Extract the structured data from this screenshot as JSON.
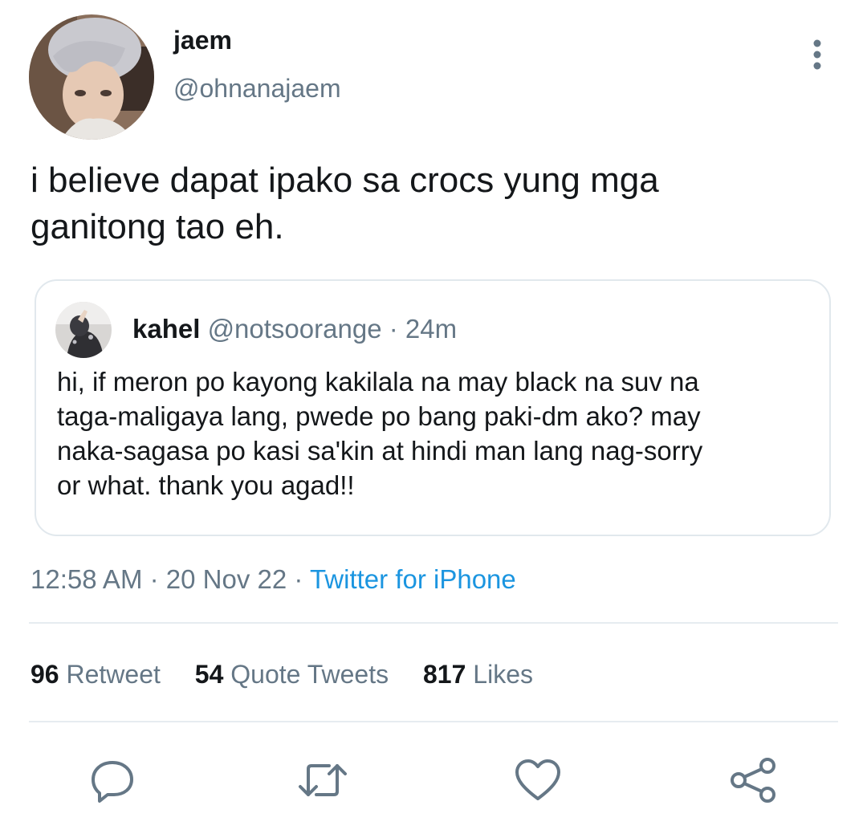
{
  "author": {
    "display_name": "jaem",
    "handle": "@ohnanajaem"
  },
  "tweet": {
    "text_line1": "i believe dapat ipako sa crocs yung mga",
    "text_line2": "ganitong tao eh."
  },
  "quoted_tweet": {
    "display_name": "kahel",
    "handle": "@notsoorange",
    "separator": "·",
    "time": "24m",
    "text_lines": [
      "hi, if meron po kayong kakilala na may black na suv na",
      "taga-maligaya lang, pwede po bang paki-dm ako? may",
      "naka-sagasa po kasi sa'kin at hindi man lang nag-sorry",
      "or what. thank you agad!!"
    ]
  },
  "meta": {
    "time": "12:58 AM",
    "sep1": "·",
    "date": "20 Nov 22",
    "sep2": "·",
    "source": "Twitter for iPhone"
  },
  "stats": {
    "retweets": {
      "count": "96",
      "label": "Retweet"
    },
    "quotes": {
      "count": "54",
      "label": "Quote Tweets"
    },
    "likes": {
      "count": "817",
      "label": "Likes"
    }
  },
  "actions": {
    "icons": [
      "reply-icon",
      "retweet-icon",
      "like-icon",
      "share-icon"
    ]
  },
  "colors": {
    "text": "#14171a",
    "secondary": "#657786",
    "link": "#1b95e0",
    "divider": "#e6ecf0",
    "card_border": "#e1e8ed"
  }
}
